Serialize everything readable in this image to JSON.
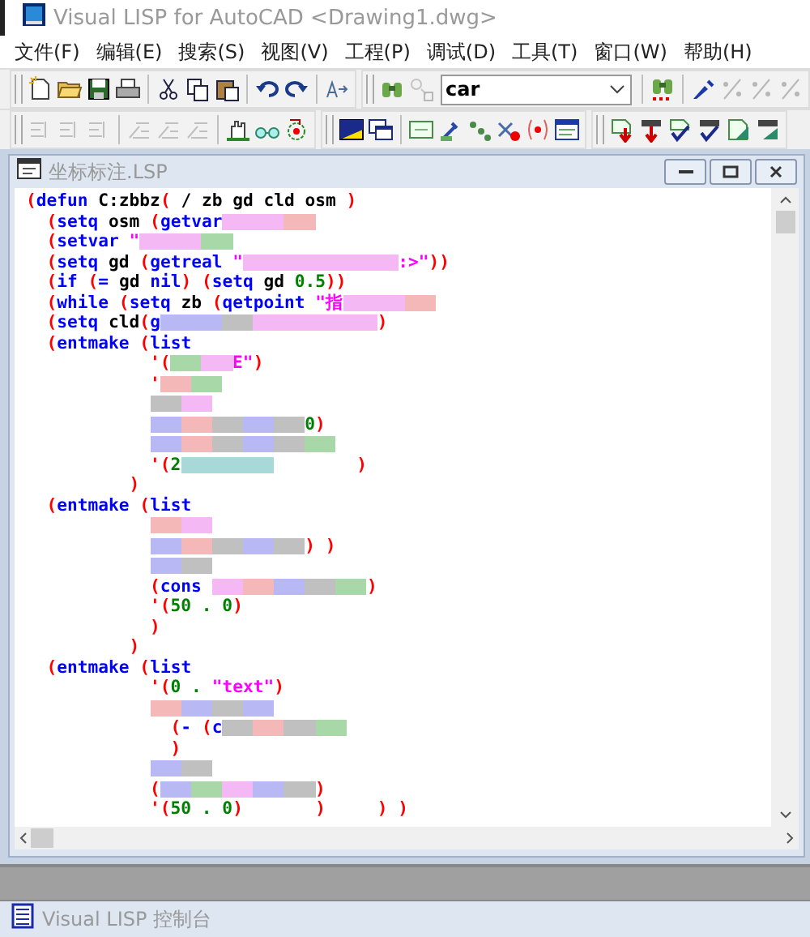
{
  "window": {
    "title": "Visual LISP for AutoCAD <Drawing1.dwg>"
  },
  "menu": [
    "文件(F)",
    "编辑(E)",
    "搜索(S)",
    "视图(V)",
    "工程(P)",
    "调试(D)",
    "工具(T)",
    "窗口(W)",
    "帮助(H)"
  ],
  "toolbars": [
    {
      "groups": [
        [
          {
            "disabled": false
          },
          {
            "disabled": false
          },
          {
            "disabled": false
          },
          {
            "disabled": false
          }
        ],
        [
          {
            "disabled": false
          },
          {
            "disabled": false
          },
          {
            "disabled": false
          }
        ],
        [
          {
            "disabled": false
          },
          {
            "disabled": false
          }
        ],
        [
          {
            "disabled": false
          }
        ]
      ]
    },
    {
      "groups": [
        [
          {
            "disabled": false
          },
          {
            "disabled": true
          }
        ],
        [
          {
            "disabled": false
          }
        ],
        [
          {
            "disabled": false
          },
          {
            "disabled": true
          },
          {
            "disabled": true
          },
          {
            "disabled": true
          }
        ]
      ],
      "search_combo": {
        "value": "car"
      }
    },
    {
      "groups": [
        [
          {
            "disabled": true
          },
          {
            "disabled": true
          },
          {
            "disabled": true
          }
        ],
        [
          {
            "disabled": true
          },
          {
            "disabled": true
          },
          {
            "disabled": true
          }
        ],
        [
          {
            "disabled": false
          },
          {
            "disabled": false
          },
          {
            "disabled": false
          }
        ]
      ]
    },
    {
      "groups": [
        [
          {
            "disabled": false
          },
          {
            "disabled": false
          }
        ],
        [
          {
            "disabled": false
          },
          {
            "disabled": false
          },
          {
            "disabled": false
          },
          {
            "disabled": false
          },
          {
            "disabled": false
          },
          {
            "disabled": false
          }
        ]
      ]
    },
    {
      "groups": [
        [
          {
            "disabled": false
          },
          {
            "disabled": false
          },
          {
            "disabled": false
          },
          {
            "disabled": false
          },
          {
            "disabled": false
          },
          {
            "disabled": false
          }
        ]
      ]
    }
  ],
  "editor": {
    "title": "坐标标注.LSP",
    "lines": [
      [
        {
          "kind": "p",
          "text": "("
        },
        {
          "kind": "k",
          "text": "defun"
        },
        {
          "kind": "t",
          "text": " C:zbbz"
        },
        {
          "kind": "p",
          "text": "("
        },
        {
          "kind": "t",
          "text": " / zb gd cld osm "
        },
        {
          "kind": "p",
          "text": ")"
        }
      ],
      [
        {
          "kind": "p",
          "text": "  ("
        },
        {
          "kind": "k",
          "text": "setq"
        },
        {
          "kind": "t",
          "text": " osm "
        },
        {
          "kind": "p",
          "text": "("
        },
        {
          "kind": "k",
          "text": "getvar"
        },
        {
          "kind": "blur",
          "color": "#f4b8f4"
        },
        {
          "kind": "blur",
          "color": "#f4b8f4"
        },
        {
          "kind": "blur",
          "color": "#f4b8b8"
        }
      ],
      [
        {
          "kind": "p",
          "text": "  ("
        },
        {
          "kind": "k",
          "text": "setvar"
        },
        {
          "kind": "s",
          "text": " \""
        },
        {
          "kind": "blur",
          "color": "#f4b8f4"
        },
        {
          "kind": "blur",
          "color": "#f4b8f4"
        },
        {
          "kind": "blur",
          "color": "#a8d8a8"
        }
      ],
      [
        {
          "kind": "p",
          "text": "  ("
        },
        {
          "kind": "k",
          "text": "setq"
        },
        {
          "kind": "t",
          "text": " gd "
        },
        {
          "kind": "p",
          "text": "("
        },
        {
          "kind": "k",
          "text": "getreal"
        },
        {
          "kind": "s",
          "text": " \""
        },
        {
          "kind": "blur",
          "color": "#f4b8f4"
        },
        {
          "kind": "blur",
          "color": "#f4b8f4"
        },
        {
          "kind": "blur",
          "color": "#f4b8f4"
        },
        {
          "kind": "blur",
          "color": "#f4b8f4"
        },
        {
          "kind": "blur",
          "color": "#f4b8f4"
        },
        {
          "kind": "s",
          "text": ":>\""
        },
        {
          "kind": "p",
          "text": "))"
        }
      ],
      [
        {
          "kind": "p",
          "text": "  ("
        },
        {
          "kind": "k",
          "text": "if "
        },
        {
          "kind": "p",
          "text": "("
        },
        {
          "kind": "k",
          "text": "="
        },
        {
          "kind": "t",
          "text": " gd "
        },
        {
          "kind": "k",
          "text": "nil"
        },
        {
          "kind": "p",
          "text": ") ("
        },
        {
          "kind": "k",
          "text": "setq"
        },
        {
          "kind": "t",
          "text": " gd "
        },
        {
          "kind": "n",
          "text": "0.5"
        },
        {
          "kind": "p",
          "text": "))"
        }
      ],
      [
        {
          "kind": "p",
          "text": "  ("
        },
        {
          "kind": "k",
          "text": "while "
        },
        {
          "kind": "p",
          "text": "("
        },
        {
          "kind": "k",
          "text": "setq"
        },
        {
          "kind": "t",
          "text": " zb "
        },
        {
          "kind": "p",
          "text": "("
        },
        {
          "kind": "k",
          "text": "qetpoint"
        },
        {
          "kind": "s",
          "text": " \"指"
        },
        {
          "kind": "blur",
          "color": "#f4b8f4"
        },
        {
          "kind": "blur",
          "color": "#f4b8f4"
        },
        {
          "kind": "blur",
          "color": "#f4b8b8"
        }
      ],
      [
        {
          "kind": "p",
          "text": "  ("
        },
        {
          "kind": "k",
          "text": "setq"
        },
        {
          "kind": "t",
          "text": " cld"
        },
        {
          "kind": "p",
          "text": "("
        },
        {
          "kind": "k",
          "text": "g"
        },
        {
          "kind": "blur",
          "color": "#b8b8f4"
        },
        {
          "kind": "blur",
          "color": "#b8b8f4"
        },
        {
          "kind": "blur",
          "color": "#c0c0c0"
        },
        {
          "kind": "blur",
          "color": "#f4b8f4"
        },
        {
          "kind": "blur",
          "color": "#f4b8f4"
        },
        {
          "kind": "blur",
          "color": "#f4b8f4"
        },
        {
          "kind": "blur",
          "color": "#f4b8f4"
        },
        {
          "kind": "p",
          "text": ")"
        }
      ],
      [
        {
          "kind": "p",
          "text": "  ("
        },
        {
          "kind": "k",
          "text": "entmake "
        },
        {
          "kind": "p",
          "text": "("
        },
        {
          "kind": "k",
          "text": "list"
        }
      ],
      [
        {
          "kind": "p",
          "text": "            '("
        },
        {
          "kind": "blur",
          "color": "#a8d8a8"
        },
        {
          "kind": "blur",
          "color": "#f4b8f4"
        },
        {
          "kind": "s",
          "text": "E\""
        },
        {
          "kind": "p",
          "text": ")"
        }
      ],
      [
        {
          "kind": "p",
          "text": "            '"
        },
        {
          "kind": "blur",
          "color": "#f4b8b8"
        },
        {
          "kind": "blur",
          "color": "#a8d8a8"
        }
      ],
      [
        {
          "kind": "blur",
          "color": "#c0c0c0"
        },
        {
          "kind": "blur",
          "color": "#f4b8f4"
        }
      ],
      [
        {
          "kind": "blur",
          "color": "#b8b8f4"
        },
        {
          "kind": "blur",
          "color": "#f4b8b8"
        },
        {
          "kind": "blur",
          "color": "#c0c0c0"
        },
        {
          "kind": "blur",
          "color": "#b8b8f4"
        },
        {
          "kind": "blur",
          "color": "#c0c0c0"
        },
        {
          "kind": "n",
          "text": "0"
        },
        {
          "kind": "p",
          "text": ")"
        }
      ],
      [
        {
          "kind": "blur",
          "color": "#b8b8f4"
        },
        {
          "kind": "blur",
          "color": "#f4b8b8"
        },
        {
          "kind": "blur",
          "color": "#c0c0c0"
        },
        {
          "kind": "blur",
          "color": "#b8b8f4"
        },
        {
          "kind": "blur",
          "color": "#c0c0c0"
        },
        {
          "kind": "blur",
          "color": "#a8d8a8"
        }
      ],
      [
        {
          "kind": "p",
          "text": "            '("
        },
        {
          "kind": "n",
          "text": "2"
        },
        {
          "kind": "blur",
          "color": "#a8d8d8"
        },
        {
          "kind": "blur",
          "color": "#a8d8d8"
        },
        {
          "kind": "blur",
          "color": "#a8d8d8"
        },
        {
          "kind": "p",
          "text": "        )"
        }
      ],
      [
        {
          "kind": "p",
          "text": "          )"
        }
      ],
      [
        {
          "kind": "p",
          "text": "  ("
        },
        {
          "kind": "k",
          "text": "entmake "
        },
        {
          "kind": "p",
          "text": "("
        },
        {
          "kind": "k",
          "text": "list"
        }
      ],
      [
        {
          "kind": "blur",
          "color": "#f4b8b8"
        },
        {
          "kind": "blur",
          "color": "#f4b8f4"
        }
      ],
      [
        {
          "kind": "blur",
          "color": "#b8b8f4"
        },
        {
          "kind": "blur",
          "color": "#f4b8b8"
        },
        {
          "kind": "blur",
          "color": "#c0c0c0"
        },
        {
          "kind": "blur",
          "color": "#b8b8f4"
        },
        {
          "kind": "blur",
          "color": "#c0c0c0"
        },
        {
          "kind": "p",
          "text": ") )"
        }
      ],
      [
        {
          "kind": "blur",
          "color": "#b8b8f4"
        },
        {
          "kind": "blur",
          "color": "#c0c0c0"
        }
      ],
      [
        {
          "kind": "p",
          "text": "            ("
        },
        {
          "kind": "k",
          "text": "cons "
        },
        {
          "kind": "blur",
          "color": "#f4b8f4"
        },
        {
          "kind": "blur",
          "color": "#f4b8b8"
        },
        {
          "kind": "blur",
          "color": "#b8b8f4"
        },
        {
          "kind": "blur",
          "color": "#c0c0c0"
        },
        {
          "kind": "blur",
          "color": "#a8d8a8"
        },
        {
          "kind": "p",
          "text": ")"
        }
      ],
      [
        {
          "kind": "p",
          "text": "            '("
        },
        {
          "kind": "n",
          "text": "50 . 0"
        },
        {
          "kind": "p",
          "text": ")"
        }
      ],
      [
        {
          "kind": "p",
          "text": "            )"
        }
      ],
      [
        {
          "kind": "p",
          "text": "          )"
        }
      ],
      [
        {
          "kind": "p",
          "text": "  ("
        },
        {
          "kind": "k",
          "text": "entmake "
        },
        {
          "kind": "p",
          "text": "("
        },
        {
          "kind": "k",
          "text": "list"
        }
      ],
      [
        {
          "kind": "p",
          "text": "            '("
        },
        {
          "kind": "n",
          "text": "0 . "
        },
        {
          "kind": "s",
          "text": "\"text\""
        },
        {
          "kind": "p",
          "text": ")"
        }
      ],
      [
        {
          "kind": "blur",
          "color": "#f4b8b8"
        },
        {
          "kind": "blur",
          "color": "#b8b8f4"
        },
        {
          "kind": "blur",
          "color": "#c0c0c0"
        },
        {
          "kind": "blur",
          "color": "#b8b8f4"
        }
      ],
      [
        {
          "kind": "p",
          "text": "              ("
        },
        {
          "kind": "k",
          "text": "- "
        },
        {
          "kind": "p",
          "text": "("
        },
        {
          "kind": "k",
          "text": "c"
        },
        {
          "kind": "blur",
          "color": "#c0c0c0"
        },
        {
          "kind": "blur",
          "color": "#f4b8b8"
        },
        {
          "kind": "blur",
          "color": "#c0c0c0"
        },
        {
          "kind": "blur",
          "color": "#a8d8a8"
        }
      ],
      [
        {
          "kind": "p",
          "text": "              )"
        }
      ],
      [
        {
          "kind": "blur",
          "color": "#b8b8f4"
        },
        {
          "kind": "blur",
          "color": "#c0c0c0"
        }
      ],
      [
        {
          "kind": "p",
          "text": "            ("
        },
        {
          "kind": "blur",
          "color": "#b8b8f4"
        },
        {
          "kind": "blur",
          "color": "#a8d8a8"
        },
        {
          "kind": "blur",
          "color": "#f4b8f4"
        },
        {
          "kind": "blur",
          "color": "#b8b8f4"
        },
        {
          "kind": "blur",
          "color": "#c0c0c0"
        },
        {
          "kind": "p",
          "text": ")"
        }
      ],
      [
        {
          "kind": "p",
          "text": "            '("
        },
        {
          "kind": "n",
          "text": "50 . 0"
        },
        {
          "kind": "p",
          "text": ")       )     ) )"
        }
      ]
    ]
  },
  "console": {
    "title": "Visual LISP 控制台"
  }
}
